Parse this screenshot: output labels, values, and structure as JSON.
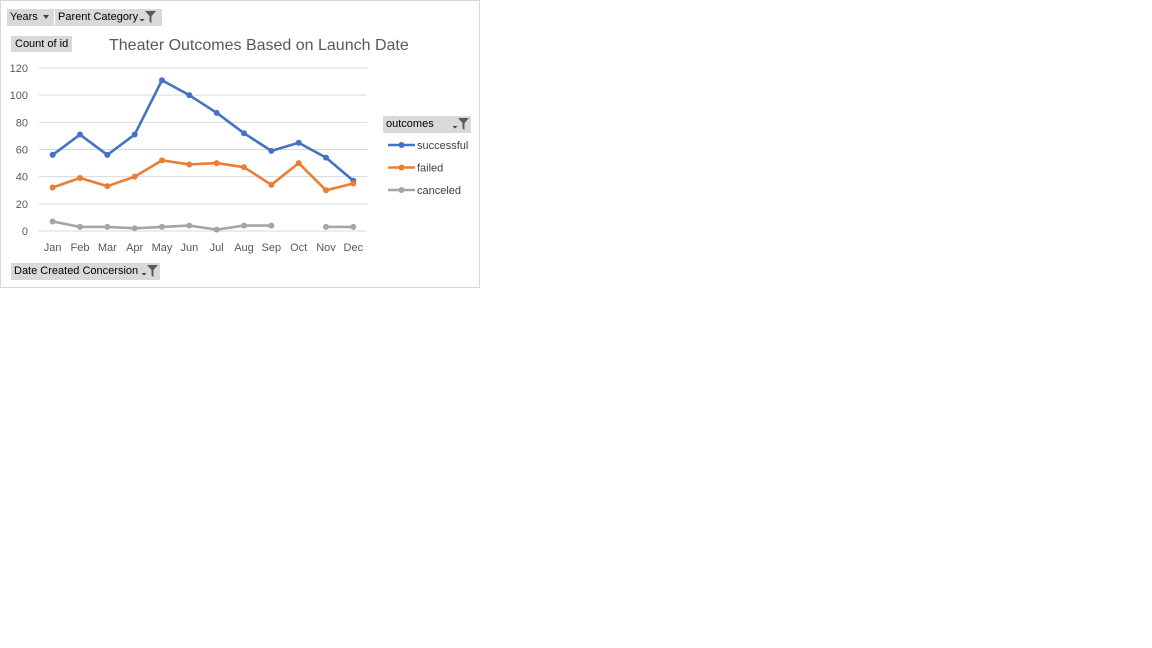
{
  "filters": {
    "years": "Years",
    "parent_category": "Parent Category",
    "legend_field": "outcomes",
    "axis_field": "Date Created Concersion",
    "value_field": "Count of id"
  },
  "colors": {
    "successful": "#4472c4",
    "failed": "#ed7d31",
    "canceled": "#a5a5a5",
    "grid": "#d9d9d9"
  },
  "chart_data": {
    "type": "line",
    "title": "Theater Outcomes Based on Launch Date",
    "xlabel": "",
    "ylabel": "",
    "categories": [
      "Jan",
      "Feb",
      "Mar",
      "Apr",
      "May",
      "Jun",
      "Jul",
      "Aug",
      "Sep",
      "Oct",
      "Nov",
      "Dec"
    ],
    "ylim": [
      0,
      120
    ],
    "yticks": [
      0,
      20,
      40,
      60,
      80,
      100,
      120
    ],
    "grid": true,
    "legend": "right",
    "series": [
      {
        "name": "successful",
        "values": [
          56,
          71,
          56,
          71,
          111,
          100,
          87,
          72,
          59,
          65,
          54,
          37
        ]
      },
      {
        "name": "failed",
        "values": [
          32,
          39,
          33,
          40,
          52,
          49,
          50,
          47,
          34,
          50,
          30,
          35
        ]
      },
      {
        "name": "canceled",
        "values": [
          7,
          3,
          3,
          2,
          3,
          4,
          1,
          4,
          4,
          null,
          3,
          3
        ]
      }
    ]
  }
}
